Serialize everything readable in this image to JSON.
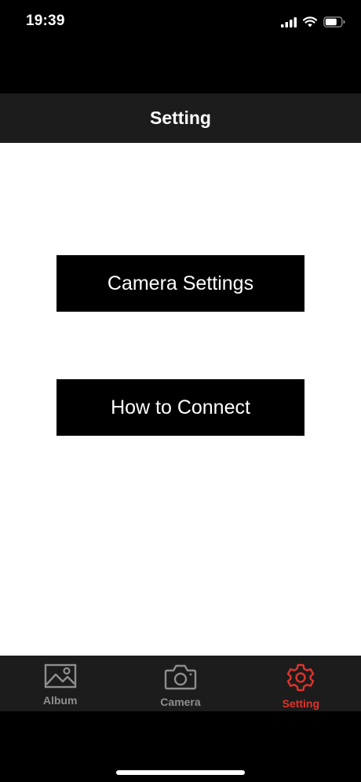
{
  "status_bar": {
    "time": "19:39",
    "icons": [
      "cellular-signal-icon",
      "wifi-icon",
      "battery-icon"
    ]
  },
  "header": {
    "title": "Setting"
  },
  "main": {
    "buttons": [
      {
        "label": "Camera Settings"
      },
      {
        "label": "How to Connect"
      }
    ]
  },
  "tab_bar": {
    "tabs": [
      {
        "label": "Album",
        "icon": "image-icon",
        "active": false
      },
      {
        "label": "Camera",
        "icon": "camera-icon",
        "active": false
      },
      {
        "label": "Setting",
        "icon": "gear-icon",
        "active": true
      }
    ],
    "inactive_color": "#8e8e8e",
    "active_color": "#e0332b"
  },
  "colors": {
    "header_background": "#1c1c1c",
    "content_background": "#ffffff",
    "button_background": "#000000",
    "accent": "#e0332b"
  }
}
